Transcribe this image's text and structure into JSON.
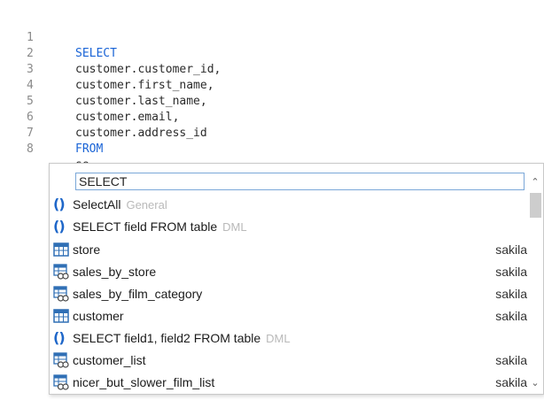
{
  "editor": {
    "lines": [
      {
        "num": "1",
        "text": "SELECT",
        "keyword": true
      },
      {
        "num": "2",
        "text": "customer.customer_id,",
        "keyword": false
      },
      {
        "num": "3",
        "text": "customer.first_name,",
        "keyword": false
      },
      {
        "num": "4",
        "text": "customer.last_name,",
        "keyword": false
      },
      {
        "num": "5",
        "text": "customer.email,",
        "keyword": false
      },
      {
        "num": "6",
        "text": "customer.address_id",
        "keyword": false
      },
      {
        "num": "7",
        "text": "FROM",
        "keyword": true
      },
      {
        "num": "8",
        "text": "se",
        "keyword": false
      }
    ]
  },
  "autocomplete": {
    "filter_value": "SELECT",
    "items": [
      {
        "label": "SelectAll",
        "category": "General",
        "schema": "",
        "icon": "snippet-icon"
      },
      {
        "label": "SELECT field FROM table",
        "category": "DML",
        "schema": "",
        "icon": "snippet-icon"
      },
      {
        "label": "store",
        "category": "",
        "schema": "sakila",
        "icon": "table-icon"
      },
      {
        "label": "sales_by_store",
        "category": "",
        "schema": "sakila",
        "icon": "view-icon"
      },
      {
        "label": "sales_by_film_category",
        "category": "",
        "schema": "sakila",
        "icon": "view-icon"
      },
      {
        "label": "customer",
        "category": "",
        "schema": "sakila",
        "icon": "table-icon"
      },
      {
        "label": "SELECT field1, field2 FROM table",
        "category": "DML",
        "schema": "",
        "icon": "snippet-icon"
      },
      {
        "label": "customer_list",
        "category": "",
        "schema": "sakila",
        "icon": "view-icon"
      },
      {
        "label": "nicer_but_slower_film_list",
        "category": "",
        "schema": "sakila",
        "icon": "view-icon"
      }
    ]
  },
  "colors": {
    "keyword": "#1a64d6",
    "snippet_icon": "#1f67c9",
    "table_icon": "#2f6fb5",
    "match_highlight": "#fff3b8"
  }
}
